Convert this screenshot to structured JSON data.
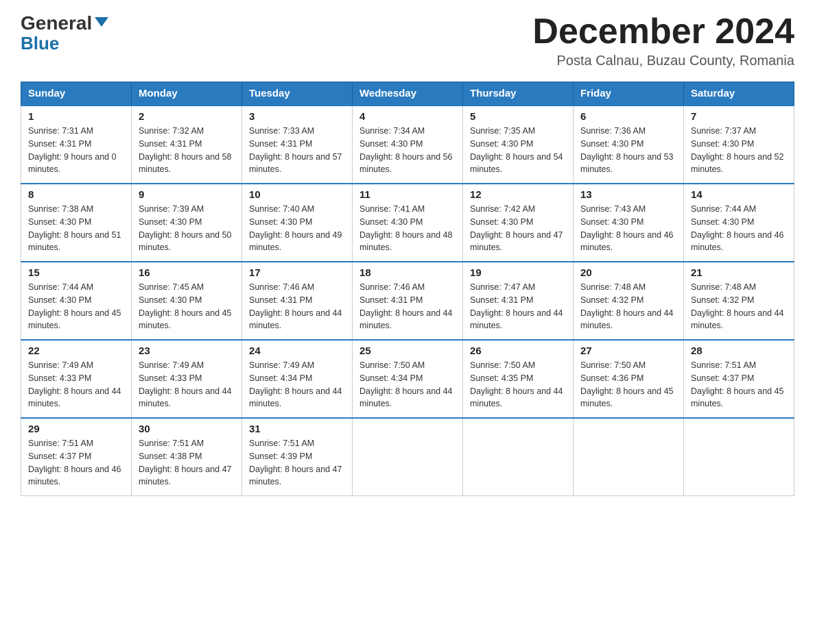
{
  "header": {
    "logo_general": "General",
    "logo_blue": "Blue",
    "month_title": "December 2024",
    "subtitle": "Posta Calnau, Buzau County, Romania"
  },
  "days_of_week": [
    "Sunday",
    "Monday",
    "Tuesday",
    "Wednesday",
    "Thursday",
    "Friday",
    "Saturday"
  ],
  "weeks": [
    [
      {
        "day": "1",
        "sunrise": "7:31 AM",
        "sunset": "4:31 PM",
        "daylight": "9 hours and 0 minutes."
      },
      {
        "day": "2",
        "sunrise": "7:32 AM",
        "sunset": "4:31 PM",
        "daylight": "8 hours and 58 minutes."
      },
      {
        "day": "3",
        "sunrise": "7:33 AM",
        "sunset": "4:31 PM",
        "daylight": "8 hours and 57 minutes."
      },
      {
        "day": "4",
        "sunrise": "7:34 AM",
        "sunset": "4:30 PM",
        "daylight": "8 hours and 56 minutes."
      },
      {
        "day": "5",
        "sunrise": "7:35 AM",
        "sunset": "4:30 PM",
        "daylight": "8 hours and 54 minutes."
      },
      {
        "day": "6",
        "sunrise": "7:36 AM",
        "sunset": "4:30 PM",
        "daylight": "8 hours and 53 minutes."
      },
      {
        "day": "7",
        "sunrise": "7:37 AM",
        "sunset": "4:30 PM",
        "daylight": "8 hours and 52 minutes."
      }
    ],
    [
      {
        "day": "8",
        "sunrise": "7:38 AM",
        "sunset": "4:30 PM",
        "daylight": "8 hours and 51 minutes."
      },
      {
        "day": "9",
        "sunrise": "7:39 AM",
        "sunset": "4:30 PM",
        "daylight": "8 hours and 50 minutes."
      },
      {
        "day": "10",
        "sunrise": "7:40 AM",
        "sunset": "4:30 PM",
        "daylight": "8 hours and 49 minutes."
      },
      {
        "day": "11",
        "sunrise": "7:41 AM",
        "sunset": "4:30 PM",
        "daylight": "8 hours and 48 minutes."
      },
      {
        "day": "12",
        "sunrise": "7:42 AM",
        "sunset": "4:30 PM",
        "daylight": "8 hours and 47 minutes."
      },
      {
        "day": "13",
        "sunrise": "7:43 AM",
        "sunset": "4:30 PM",
        "daylight": "8 hours and 46 minutes."
      },
      {
        "day": "14",
        "sunrise": "7:44 AM",
        "sunset": "4:30 PM",
        "daylight": "8 hours and 46 minutes."
      }
    ],
    [
      {
        "day": "15",
        "sunrise": "7:44 AM",
        "sunset": "4:30 PM",
        "daylight": "8 hours and 45 minutes."
      },
      {
        "day": "16",
        "sunrise": "7:45 AM",
        "sunset": "4:30 PM",
        "daylight": "8 hours and 45 minutes."
      },
      {
        "day": "17",
        "sunrise": "7:46 AM",
        "sunset": "4:31 PM",
        "daylight": "8 hours and 44 minutes."
      },
      {
        "day": "18",
        "sunrise": "7:46 AM",
        "sunset": "4:31 PM",
        "daylight": "8 hours and 44 minutes."
      },
      {
        "day": "19",
        "sunrise": "7:47 AM",
        "sunset": "4:31 PM",
        "daylight": "8 hours and 44 minutes."
      },
      {
        "day": "20",
        "sunrise": "7:48 AM",
        "sunset": "4:32 PM",
        "daylight": "8 hours and 44 minutes."
      },
      {
        "day": "21",
        "sunrise": "7:48 AM",
        "sunset": "4:32 PM",
        "daylight": "8 hours and 44 minutes."
      }
    ],
    [
      {
        "day": "22",
        "sunrise": "7:49 AM",
        "sunset": "4:33 PM",
        "daylight": "8 hours and 44 minutes."
      },
      {
        "day": "23",
        "sunrise": "7:49 AM",
        "sunset": "4:33 PM",
        "daylight": "8 hours and 44 minutes."
      },
      {
        "day": "24",
        "sunrise": "7:49 AM",
        "sunset": "4:34 PM",
        "daylight": "8 hours and 44 minutes."
      },
      {
        "day": "25",
        "sunrise": "7:50 AM",
        "sunset": "4:34 PM",
        "daylight": "8 hours and 44 minutes."
      },
      {
        "day": "26",
        "sunrise": "7:50 AM",
        "sunset": "4:35 PM",
        "daylight": "8 hours and 44 minutes."
      },
      {
        "day": "27",
        "sunrise": "7:50 AM",
        "sunset": "4:36 PM",
        "daylight": "8 hours and 45 minutes."
      },
      {
        "day": "28",
        "sunrise": "7:51 AM",
        "sunset": "4:37 PM",
        "daylight": "8 hours and 45 minutes."
      }
    ],
    [
      {
        "day": "29",
        "sunrise": "7:51 AM",
        "sunset": "4:37 PM",
        "daylight": "8 hours and 46 minutes."
      },
      {
        "day": "30",
        "sunrise": "7:51 AM",
        "sunset": "4:38 PM",
        "daylight": "8 hours and 47 minutes."
      },
      {
        "day": "31",
        "sunrise": "7:51 AM",
        "sunset": "4:39 PM",
        "daylight": "8 hours and 47 minutes."
      },
      null,
      null,
      null,
      null
    ]
  ]
}
